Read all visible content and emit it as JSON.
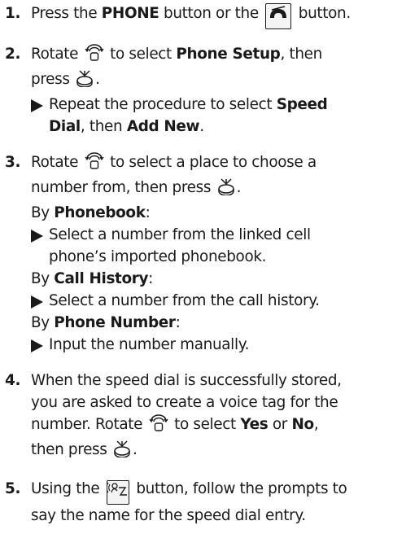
{
  "steps": [
    {
      "num": "1.",
      "t1": "Press the ",
      "b1": "PHONE",
      "t2": " button or the ",
      "t3": " button."
    },
    {
      "num": "2.",
      "t1": "Rotate ",
      "t2": " to select ",
      "b1": "Phone Setup",
      "t3": ", then",
      "t4": "press ",
      "t5": ".",
      "sub": {
        "t1": "Repeat the procedure to select ",
        "b1": "Speed",
        "b2": "Dial",
        "t2": ", then ",
        "b3": "Add New",
        "t3": "."
      }
    },
    {
      "num": "3.",
      "t1": "Rotate ",
      "t2": " to select a place to choose a",
      "t3": "number from, then press ",
      "t4": ".",
      "options": [
        {
          "pre": "By ",
          "name": "Phonebook",
          "post": ":",
          "desc1": "Select a number from the linked cell",
          "desc2": "phone’s imported phonebook."
        },
        {
          "pre": "By ",
          "name": "Call History",
          "post": ":",
          "desc1": "Select a number from the call history."
        },
        {
          "pre": "By ",
          "name": "Phone Number",
          "post": ":",
          "desc1": "Input the number manually."
        }
      ]
    },
    {
      "num": "4.",
      "l1": "When the speed dial is successfully stored,",
      "l2": "you are asked to create a voice tag for the",
      "t1": "number. Rotate ",
      "t2": " to select ",
      "b1": "Yes",
      "t3": " or ",
      "b2": "No",
      "t4": ",",
      "t5": "then press ",
      "t6": "."
    },
    {
      "num": "5.",
      "t1": "Using the ",
      "t2": " button, follow the prompts to",
      "l2": "say the name for the speed dial entry."
    }
  ],
  "icons": {
    "phone_button": "phone-button-icon",
    "selector_knob": "selector-knob-icon",
    "enter_press": "enter-press-icon",
    "talk_button": "talk-button-icon"
  },
  "colors": {
    "text": "#1a1a1a",
    "background": "#ffffff"
  }
}
